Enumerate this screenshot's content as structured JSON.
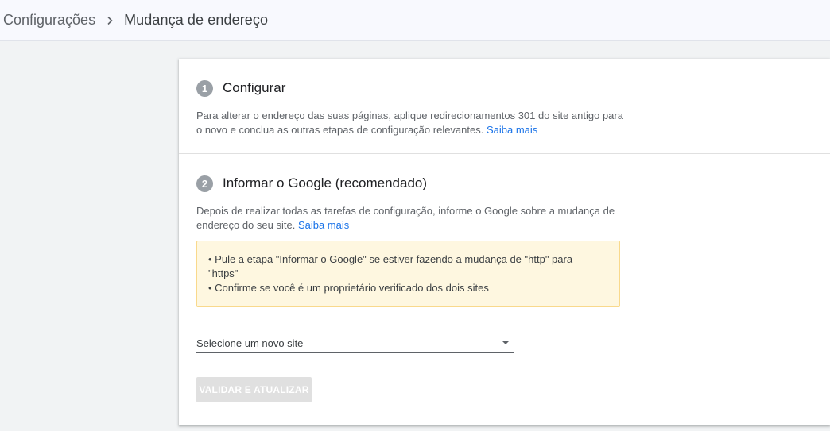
{
  "breadcrumb": {
    "root": "Configurações",
    "current": "Mudança de endereço"
  },
  "step1": {
    "number": "1",
    "title": "Configurar",
    "description": "Para alterar o endereço das suas páginas, aplique redirecionamentos 301 do site antigo para o novo e conclua as outras etapas de configuração relevantes.",
    "link": "Saiba mais"
  },
  "step2": {
    "number": "2",
    "title": "Informar o Google (recomendado)",
    "description": "Depois de realizar todas as tarefas de configuração, informe o Google sobre a mudança de endereço do seu site.",
    "link": "Saiba mais",
    "notice": [
      "• Pule a etapa \"Informar o Google\" se estiver fazendo a mudança de \"http\" para \"https\"",
      "• Confirme se você é um proprietário verificado dos dois sites"
    ],
    "select_label": "Selecione um novo site",
    "button_label": "VALIDAR E ATUALIZAR"
  },
  "icons": {
    "separator": "chevron-right-icon",
    "dropdown": "arrow-drop-down-icon"
  },
  "colors": {
    "link": "#1a73e8",
    "notice_bg": "#fef7e0",
    "notice_border": "#f9d98c",
    "badge": "#9aa0a6",
    "button_disabled": "#e0e0e0"
  }
}
